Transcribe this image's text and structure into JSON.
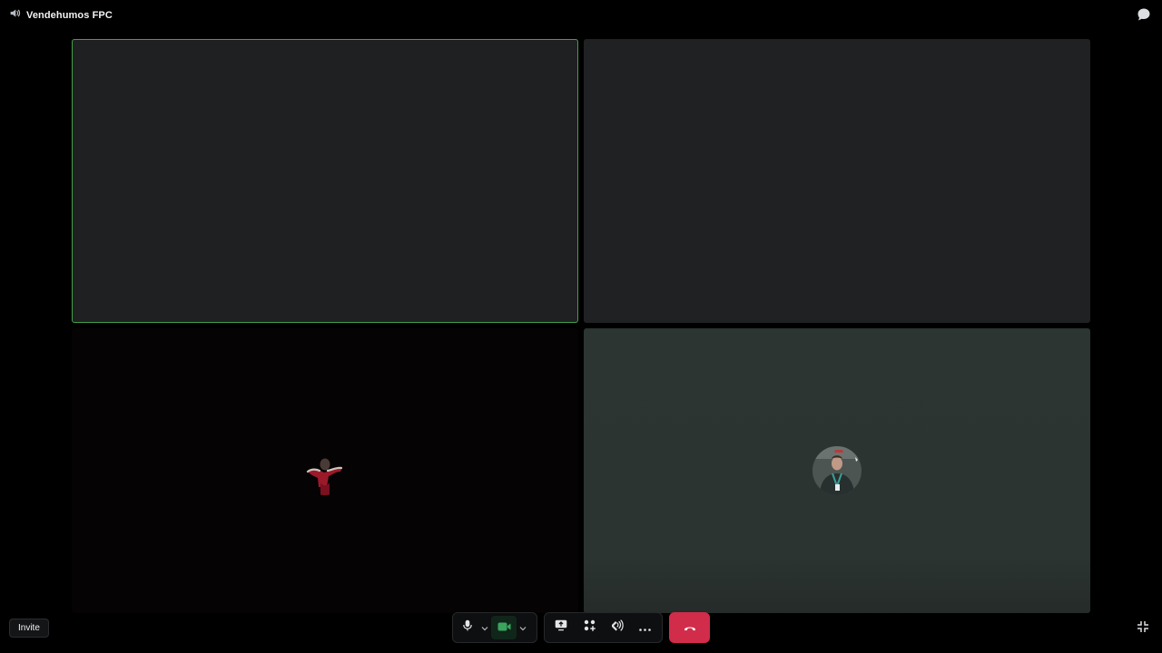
{
  "header": {
    "channel_icon": "speaker-icon",
    "channel_name": "Vendehumos FPC",
    "chat_icon": "chat-bubble-icon"
  },
  "tiles": [
    {
      "id": "tile-1",
      "speaking": true,
      "has_avatar": false
    },
    {
      "id": "tile-2",
      "speaking": false,
      "has_avatar": false
    },
    {
      "id": "tile-3",
      "speaking": false,
      "has_avatar": true,
      "avatar_icon": "user-avatar"
    },
    {
      "id": "tile-4",
      "speaking": false,
      "has_avatar": true,
      "avatar_icon": "user-avatar"
    }
  ],
  "footer": {
    "invite_label": "Invite",
    "icons": [
      "microphone-icon",
      "chevron-down-icon",
      "camera-icon",
      "chevron-down-icon",
      "screen-share-icon",
      "activity-icon",
      "soundboard-icon",
      "more-icon",
      "hangup-icon",
      "exit-fullscreen-icon"
    ]
  },
  "colors": {
    "speaking_border": "#43a047",
    "camera_active": "#3ba55d",
    "hangup": "#d22c4b"
  }
}
